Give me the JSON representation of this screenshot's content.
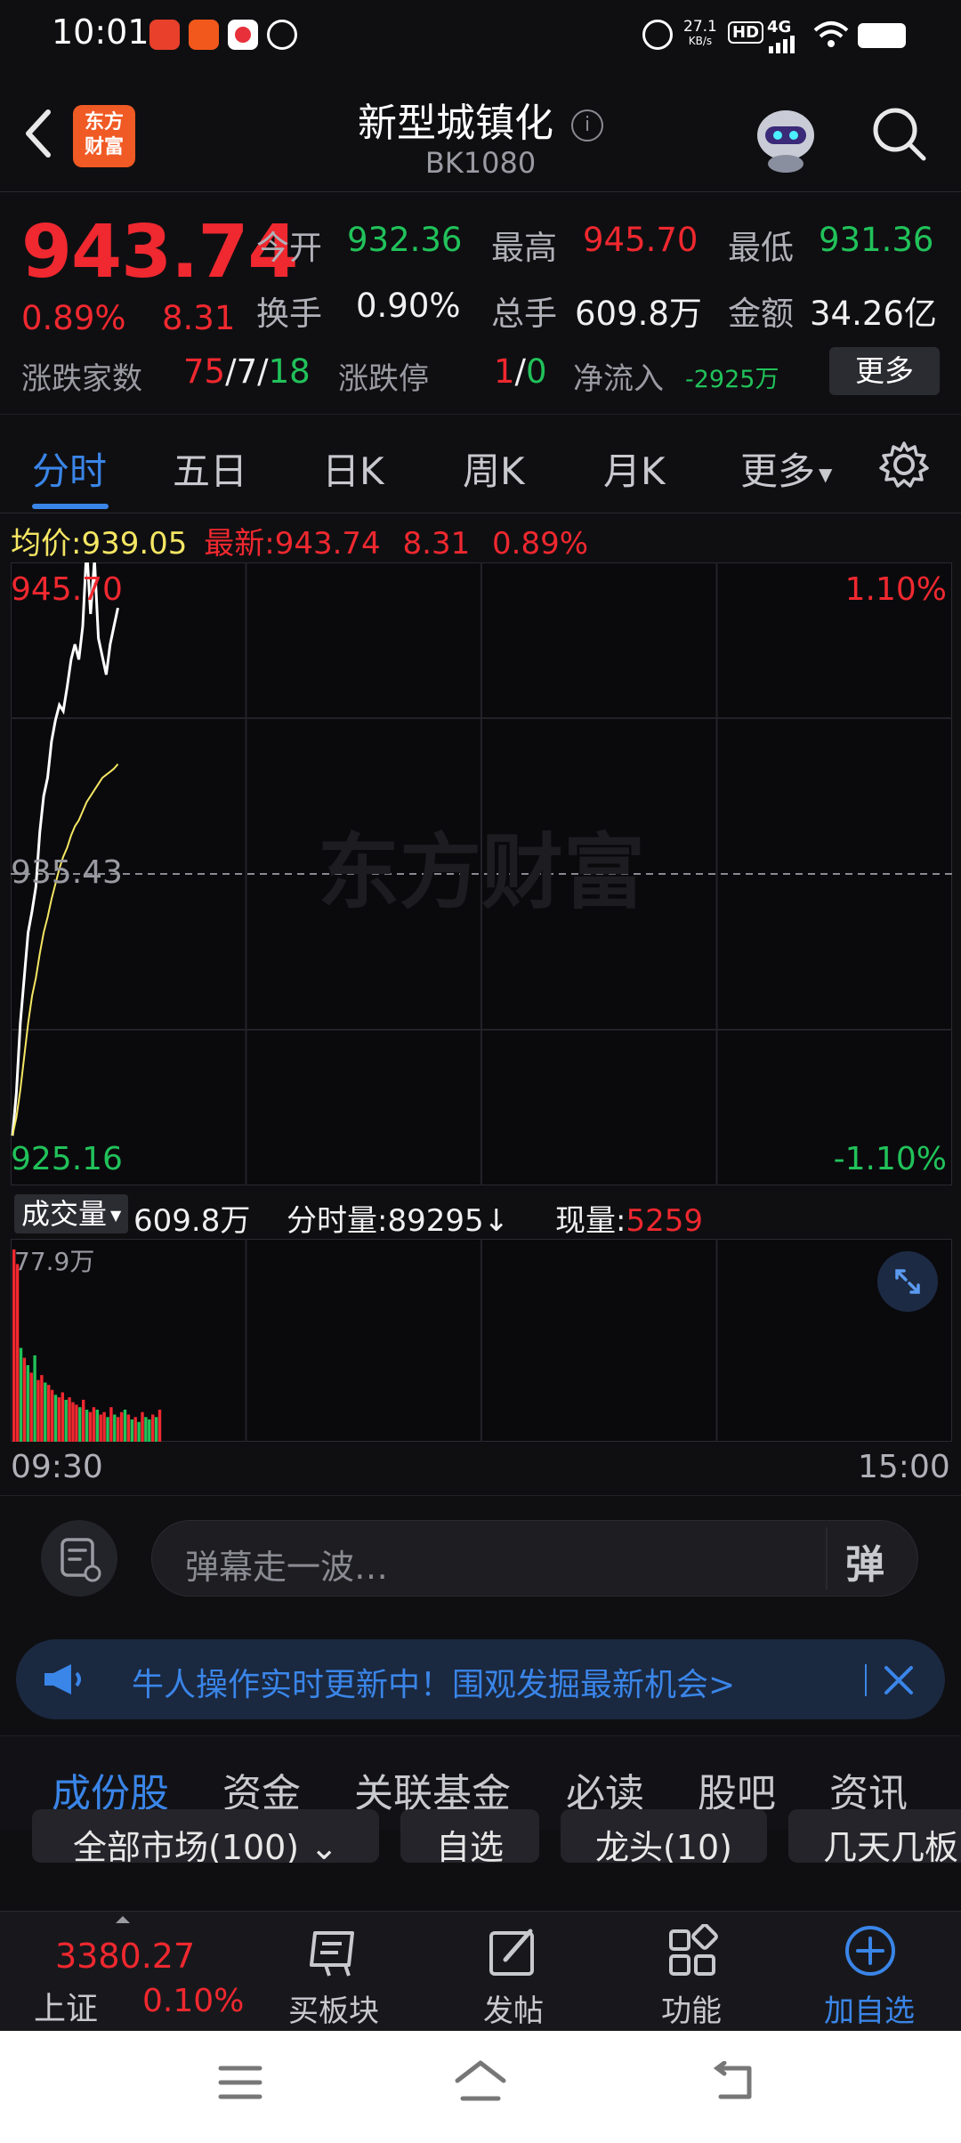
{
  "status_bar": {
    "time": "10:01",
    "speed": "27.1",
    "speed_unit": "KB/s",
    "hd": "HD",
    "network": "4G"
  },
  "header": {
    "logo_text": "东方财富",
    "title": "新型城镇化",
    "code": "BK1080"
  },
  "quote": {
    "price": "943.74",
    "change_pct": "0.89%",
    "change": "8.31",
    "open_label": "今开",
    "open": "932.36",
    "high_label": "最高",
    "high": "945.70",
    "low_label": "最低",
    "low": "931.36",
    "turnover_label": "换手",
    "turnover": "0.90%",
    "volume_label": "总手",
    "volume": "609.8万",
    "amount_label": "金额",
    "amount": "34.26亿",
    "breadth_label": "涨跌家数",
    "breadth_up": "75",
    "breadth_flat": "7",
    "breadth_down": "18",
    "limit_label": "涨跌停",
    "limit_up": "1",
    "limit_down": "0",
    "netflow_label": "净流入",
    "netflow": "-2925万",
    "more_button": "更多",
    "slash": "/"
  },
  "tabs": {
    "items": [
      "分时",
      "五日",
      "日K",
      "周K",
      "月K",
      "更多"
    ]
  },
  "info_line": {
    "avg_label": "均价:",
    "avg": "939.05",
    "latest_label": "最新:",
    "latest": "943.74",
    "latest_change": "8.31",
    "latest_pct": "0.89%"
  },
  "chart_data": {
    "type": "line",
    "ymax_label": "945.70",
    "ymid_label": "935.43",
    "ymin_label": "925.16",
    "pct_max_label": "1.10%",
    "pct_min_label": "-1.10%",
    "ylim": [
      925.16,
      945.7
    ],
    "watermark": "东方财富",
    "series": [
      {
        "values": [
          926.8,
          928.2,
          930.5,
          932.0,
          933.5,
          934.2,
          935.0,
          936.8,
          938.0,
          938.6,
          939.8,
          940.5,
          941.0,
          940.8,
          941.6,
          942.5,
          943.0,
          942.5,
          943.6,
          946.2,
          944.0,
          945.8,
          943.2,
          942.6,
          942.0,
          943.0,
          943.6,
          944.2
        ]
      },
      {
        "values": [
          926.8,
          927.4,
          928.3,
          929.4,
          930.5,
          931.4,
          932.0,
          932.8,
          933.5,
          934.0,
          934.6,
          935.1,
          935.6,
          936.0,
          936.3,
          936.7,
          937.0,
          937.2,
          937.5,
          937.8,
          938.0,
          938.2,
          938.4,
          938.6,
          938.7,
          938.8,
          938.9,
          939.05
        ]
      }
    ],
    "volume": {
      "bar_label": "成交量",
      "total": "609.8万",
      "minute_label": "分时量:",
      "minute": "89295",
      "minute_arrow": "↓",
      "now_label": "现量:",
      "now": "5259",
      "ymax_label": "77.9万",
      "ymax": 77.9,
      "values": [
        77.9,
        72.0,
        38.0,
        34.0,
        31.0,
        28.0,
        35.0,
        25.0,
        27.0,
        24.0,
        23.0,
        21.0,
        19.0,
        18.0,
        20.0,
        17.0,
        18.0,
        16.0,
        15.0,
        14.0,
        17.0,
        13.0,
        12.0,
        14.0,
        13.0,
        11.0,
        12.0,
        10.0,
        14.0,
        11.0,
        10.0,
        12.0,
        13.0,
        11.0,
        9.0,
        10.0,
        8.0,
        12.0,
        10.0,
        9.0,
        11.0,
        10.0,
        13.0
      ],
      "colors": [
        "r",
        "r",
        "g",
        "r",
        "g",
        "r",
        "g",
        "r",
        "r",
        "g",
        "r",
        "r",
        "g",
        "r",
        "r",
        "g",
        "r",
        "r",
        "r",
        "g",
        "r",
        "g",
        "r",
        "r",
        "g",
        "r",
        "r",
        "g",
        "r",
        "g",
        "r",
        "r",
        "g",
        "r",
        "g",
        "r",
        "g",
        "r",
        "g",
        "g",
        "r",
        "g",
        "r"
      ]
    },
    "x_start": "09:30",
    "x_end": "15:00"
  },
  "comment": {
    "placeholder": "弹幕走一波…",
    "send_label": "弹"
  },
  "banner": {
    "text": "牛人操作实时更新中！围观发掘最新机会>"
  },
  "lower_tabs": [
    "成份股",
    "资金",
    "关联基金",
    "必读",
    "股吧",
    "资讯"
  ],
  "chips": [
    "全部市场(100)",
    "自选",
    "龙头(10)",
    "几天几板"
  ],
  "bottom_nav": {
    "index_value": "3380.27",
    "index_name": "上证",
    "index_pct": "0.10%",
    "buy_block": "买板块",
    "post": "发帖",
    "function": "功能",
    "add_watch": "加自选"
  },
  "colors": {
    "up": "#f0282f",
    "down": "#21c25a",
    "accent": "#3a85e8",
    "avg_line": "#f5e663"
  }
}
